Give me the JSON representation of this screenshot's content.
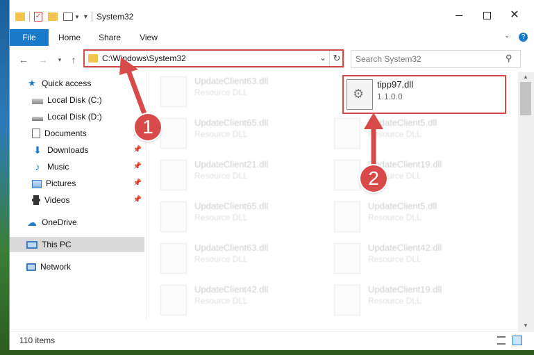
{
  "window": {
    "title": "System32"
  },
  "ribbon": {
    "tabs": [
      "File",
      "Home",
      "Share",
      "View"
    ]
  },
  "address": {
    "path": "C:\\Windows\\System32"
  },
  "search": {
    "placeholder": "Search System32"
  },
  "sidebar": {
    "items": [
      {
        "label": "Quick access",
        "icon": "star-icon"
      },
      {
        "label": "Local Disk (C:)",
        "icon": "drive-icon"
      },
      {
        "label": "Local Disk (D:)",
        "icon": "drive-icon"
      },
      {
        "label": "Documents",
        "icon": "documents-icon"
      },
      {
        "label": "Downloads",
        "icon": "download-icon"
      },
      {
        "label": "Music",
        "icon": "music-icon"
      },
      {
        "label": "Pictures",
        "icon": "pictures-icon"
      },
      {
        "label": "Videos",
        "icon": "videos-icon"
      },
      {
        "label": "OneDrive",
        "icon": "cloud-icon"
      },
      {
        "label": "This PC",
        "icon": "computer-icon"
      },
      {
        "label": "Network",
        "icon": "network-icon"
      }
    ]
  },
  "files": {
    "highlighted": {
      "name": "tipp97.dll",
      "desc": "1.1.0.0"
    },
    "left": [
      {
        "name": "UpdateClient63.dll",
        "desc": "Resource DLL"
      },
      {
        "name": "UpdateClient65.dll",
        "desc": "Resource DLL"
      },
      {
        "name": "UpdateClient21.dll",
        "desc": "Resource DLL"
      },
      {
        "name": "UpdateClient65.dll",
        "desc": "Resource DLL"
      },
      {
        "name": "UpdateClient63.dll",
        "desc": "Resource DLL"
      },
      {
        "name": "UpdateClient42.dll",
        "desc": "Resource DLL"
      }
    ],
    "right": [
      {
        "name": "UpdateClient5.dll",
        "desc": "Resource DLL"
      },
      {
        "name": "UpdateClient19.dll",
        "desc": "Resource DLL"
      },
      {
        "name": "UpdateClient5.dll",
        "desc": "Resource DLL"
      },
      {
        "name": "UpdateClient42.dll",
        "desc": "Resource DLL"
      },
      {
        "name": "UpdateClient19.dll",
        "desc": "Resource DLL"
      }
    ]
  },
  "status": {
    "count": "110 items"
  },
  "annotations": {
    "marker1": "1",
    "marker2": "2"
  },
  "colors": {
    "accent": "#1979ca",
    "highlight": "#d84a4a",
    "folder": "#f3c54e"
  }
}
